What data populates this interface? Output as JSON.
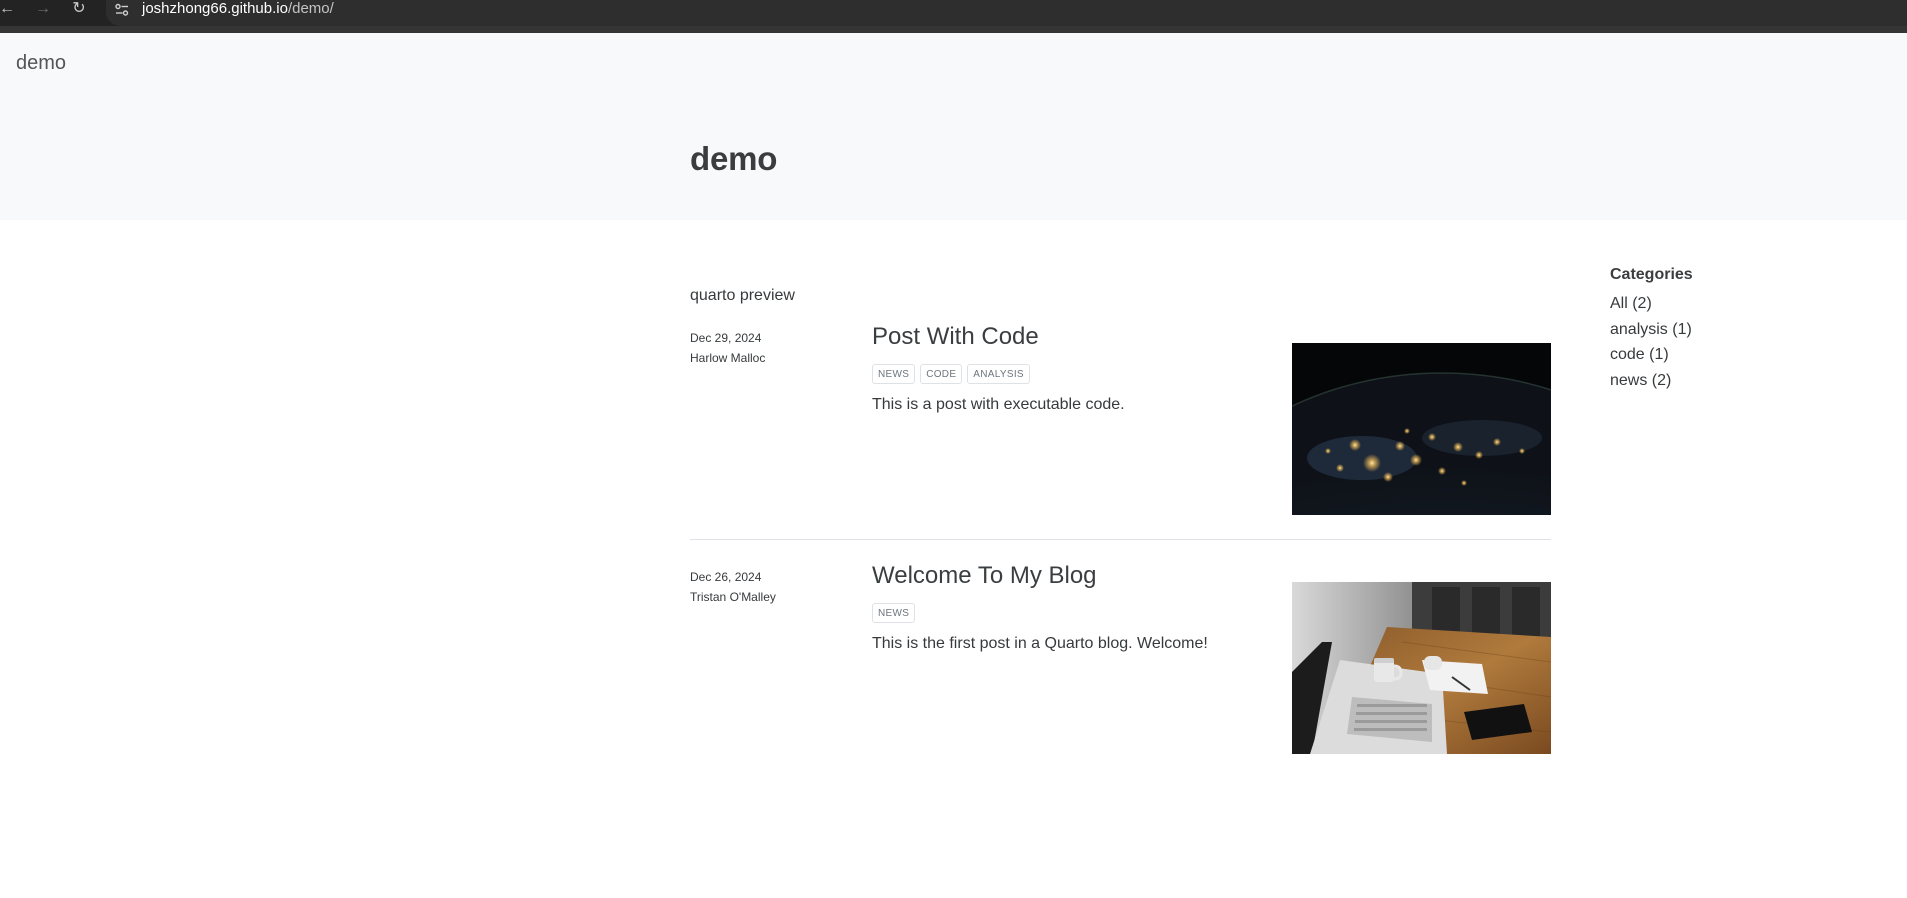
{
  "browser": {
    "url_host": "joshzhong66.github.io",
    "url_path": "/demo/",
    "back_icon": "back-arrow-icon",
    "forward_icon": "forward-arrow-icon",
    "reload_icon": "reload-icon",
    "site_info_icon": "site-settings-icon"
  },
  "navbar": {
    "brand": "demo"
  },
  "banner": {
    "title": "demo"
  },
  "listing": {
    "description": "quarto preview",
    "posts": [
      {
        "date": "Dec 29, 2024",
        "author": "Harlow Malloc",
        "title": "Post With Code",
        "categories": [
          "NEWS",
          "CODE",
          "ANALYSIS"
        ],
        "description": "This is a post with executable code.",
        "thumbnail": "earth-at-night-image"
      },
      {
        "date": "Dec 26, 2024",
        "author": "Tristan O'Malley",
        "title": "Welcome To My Blog",
        "categories": [
          "NEWS"
        ],
        "description": "This is the first post in a Quarto blog. Welcome!",
        "thumbnail": "laptop-desk-image"
      }
    ]
  },
  "sidebar": {
    "heading": "Categories",
    "items": [
      "All (2)",
      "analysis (1)",
      "code (1)",
      "news (2)"
    ]
  },
  "colors": {
    "chrome_bg": "#232323",
    "header_band": "#f8f9fa",
    "text": "#373a3c",
    "muted": "#6c757d",
    "border": "#dee2e6"
  }
}
